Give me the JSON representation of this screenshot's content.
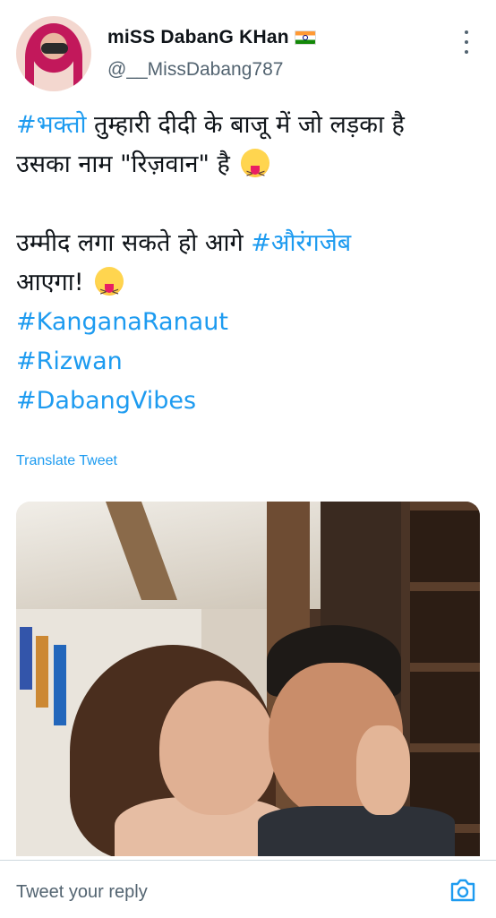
{
  "author": {
    "display_name": "miSS DabanG KHan",
    "handle": "@__MissDabang787",
    "flag_icon": "india-flag-icon"
  },
  "tweet": {
    "hashtag_bhakto": "#भक्तो",
    "line1_rest": " तुम्हारी दीदी के बाजू में जो लड़का है",
    "line2": "उसका नाम \"रिज़वान\" है",
    "line3_text": "उम्मीद लगा सकते हो आगे ",
    "hashtag_aurangzeb": "#औरंगजेब",
    "line4_text": "आएगा!",
    "hashtags": [
      "#KanganaRanaut",
      "#Rizwan",
      "#DabangVibes"
    ],
    "emoji_icon": "squinting-face-with-tongue-icon"
  },
  "translate_label": "Translate Tweet",
  "reply": {
    "placeholder": "Tweet your reply",
    "camera_icon": "camera-icon"
  },
  "colors": {
    "accent": "#1d9bf0",
    "secondary_text": "#536471"
  }
}
